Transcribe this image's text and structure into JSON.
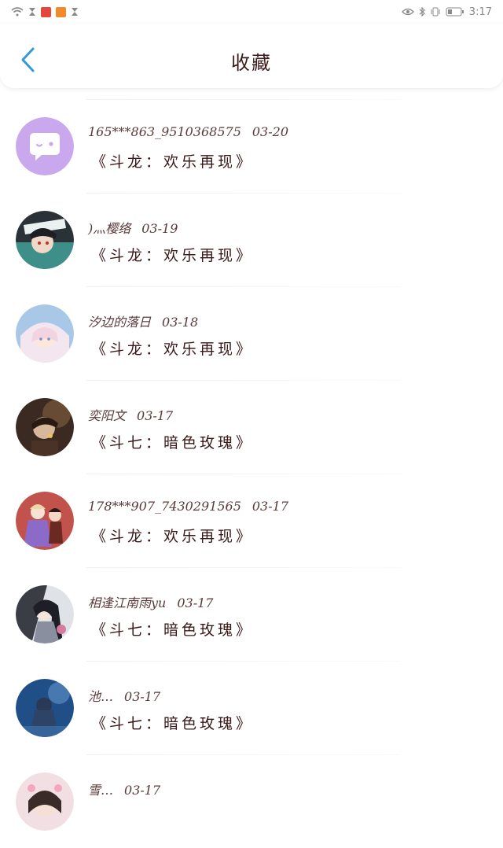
{
  "status": {
    "time": "3:17"
  },
  "header": {
    "title": "收藏"
  },
  "favorites": [
    {
      "user": "165***863_9510368575",
      "date": "03-20",
      "book": "《斗龙：欢乐再现》",
      "avatar": "bubble-logo"
    },
    {
      "user": ")灬樱络",
      "date": "03-19",
      "book": "《斗龙：欢乐再现》",
      "avatar": "anime-boy"
    },
    {
      "user": "汐边的落日",
      "date": "03-18",
      "book": "《斗龙：欢乐再现》",
      "avatar": "anime-girl-pink"
    },
    {
      "user": "奕阳文",
      "date": "03-17",
      "book": "《斗七：暗色玫瑰》",
      "avatar": "anime-dark"
    },
    {
      "user": "178***907_7430291565",
      "date": "03-17",
      "book": "《斗龙：欢乐再现》",
      "avatar": "anime-duo-red"
    },
    {
      "user": "相逢江南雨yu",
      "date": "03-17",
      "book": "《斗七：暗色玫瑰》",
      "avatar": "anime-dark-hair"
    },
    {
      "user": "池…",
      "date": "03-17",
      "book": "《斗七：暗色玫瑰》",
      "avatar": "anime-blue"
    },
    {
      "user": "雪…",
      "date": "03-17",
      "book": "",
      "avatar": "photo-girl"
    }
  ],
  "colors": {
    "accent": "#2f9bdc",
    "title": "#3c1a1a"
  }
}
